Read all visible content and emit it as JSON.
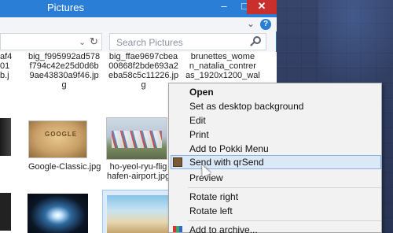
{
  "window": {
    "title": "Pictures"
  },
  "titlebar_buttons": {
    "minimize": "–",
    "maximize": "□",
    "close": "✕"
  },
  "ribbon": {
    "collapse": "⌄",
    "help": "?"
  },
  "address": {
    "dropdown": "⌄",
    "refresh": "↻"
  },
  "search": {
    "placeholder": "Search Pictures"
  },
  "files": {
    "row1": [
      {
        "label": "af4\n01\nb.j"
      },
      {
        "label": "big_f995992ad578\nf794c42e25d0d6b\n9ae43830a9f46.jp\ng"
      },
      {
        "label": "big_ffae9697cbea\n00868f2bde693a2\neba58c5c11226.jp\ng"
      },
      {
        "label": "brunettes_wome\nn_natalia_contrer\nas_1920x1200_wal"
      }
    ],
    "row2": [
      {
        "label": "Google-Classic.jpg"
      },
      {
        "label": "ho-yeol-ryu-flig\nhafen-airport.jpg"
      }
    ]
  },
  "thumb_text": {
    "google": "GOOGLE"
  },
  "context_menu": {
    "items": [
      "Open",
      "Set as desktop background",
      "Edit",
      "Print",
      "Add to Pokki Menu",
      "Send with qrSend",
      "Preview",
      "Rotate right",
      "Rotate left",
      "Add to archive..."
    ],
    "highlighted_index": 5
  },
  "colors": {
    "titlebar": "#2b7ed5",
    "highlight": "#dbe8f7",
    "close": "#c9302c"
  },
  "icons": {
    "qrsend": "qrsend-icon",
    "archive": "archive-icon",
    "search": "search-icon",
    "cursor": "mouse-cursor-icon"
  }
}
